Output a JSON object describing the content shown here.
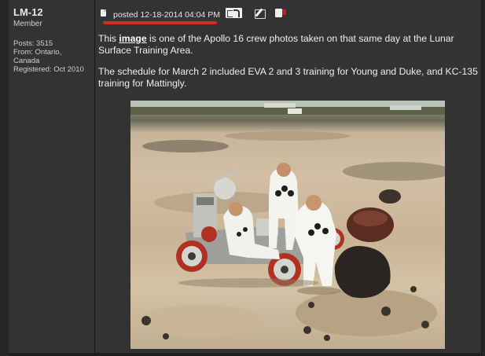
{
  "user": {
    "name": "LM-12",
    "rank": "Member",
    "posts": "Posts: 3515",
    "from_line1": "From: Ontario,",
    "from_line2": "Canada",
    "registered": "Registered: Oct 2010"
  },
  "post": {
    "posted": "posted 12-18-2014 04:04 PM",
    "body": {
      "p1_before": "This ",
      "p1_link": "image",
      "p1_after": " is one of the Apollo 16 crew photos taken on that same day at the Lunar Surface Training Area.",
      "p2": "The schedule for March 2 included EVA 2 and 3 training for Young and Duke, and KC-135 training for Mattingly."
    }
  },
  "icons": [
    "document-icon",
    "quote-icon",
    "edit-icon",
    "report-icon"
  ],
  "colors": {
    "background": "#262626",
    "panel": "#333333",
    "highlight_underline": "#d42a2a",
    "link": "#ffffff"
  }
}
